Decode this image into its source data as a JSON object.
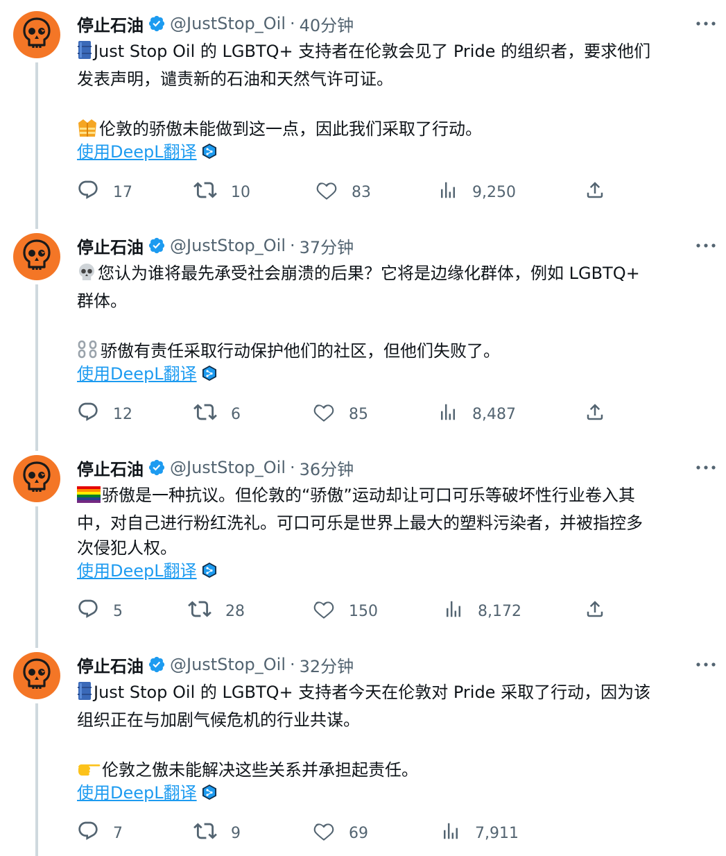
{
  "tweets": [
    {
      "name": "停止石油",
      "handle": "@JustStop_Oil",
      "separator": "·",
      "time": "40分钟",
      "lines": [
        {
          "emoji": "barrel-emoji",
          "text": "Just Stop Oil 的 LGBTQ+ 支持者在伦敦会见了 Pride 的组织者，要求他们"
        },
        {
          "emoji": "",
          "text": "发表声明，谴责新的石油和天然气许可证。"
        },
        {
          "emoji": "",
          "text": ""
        },
        {
          "emoji": "safety-vest-emoji",
          "text": "伦敦的骄傲未能做到这一点，因此我们采取了行动。"
        }
      ],
      "translate_label": "使用DeepL翻译",
      "replies": "17",
      "retweets": "10",
      "likes": "83",
      "views": "9,250",
      "show_share": true
    },
    {
      "name": "停止石油",
      "handle": "@JustStop_Oil",
      "separator": "·",
      "time": "37分钟",
      "lines": [
        {
          "emoji": "skull-emoji",
          "text": "您认为谁将最先承受社会崩溃的后果？它将是边缘化群体，例如 LGBTQ+"
        },
        {
          "emoji": "",
          "text": "群体。"
        },
        {
          "emoji": "",
          "text": ""
        },
        {
          "emoji": "broken-chain-emoji",
          "text": "骄傲有责任采取行动保护他们的社区，但他们失败了。"
        }
      ],
      "translate_label": "使用DeepL翻译",
      "replies": "12",
      "retweets": "6",
      "likes": "85",
      "views": "8,487",
      "show_share": true
    },
    {
      "name": "停止石油",
      "handle": "@JustStop_Oil",
      "separator": "·",
      "time": "36分钟",
      "lines": [
        {
          "emoji": "rainbow-flag-emoji",
          "text": "骄傲是一种抗议。但伦敦的“骄傲”运动却让可口可乐等破坏性行业卷入其"
        },
        {
          "emoji": "",
          "text": "中，对自己进行粉红洗礼。可口可乐是世界上最大的塑料污染者，并被指控多"
        },
        {
          "emoji": "",
          "text": "次侵犯人权。"
        }
      ],
      "translate_label": "使用DeepL翻译",
      "replies": "5",
      "retweets": "28",
      "likes": "150",
      "views": "8,172",
      "show_share": true
    },
    {
      "name": "停止石油",
      "handle": "@JustStop_Oil",
      "separator": "·",
      "time": "32分钟",
      "lines": [
        {
          "emoji": "barrel-emoji",
          "text": "Just Stop Oil 的 LGBTQ+ 支持者今天在伦敦对 Pride 采取了行动，因为该"
        },
        {
          "emoji": "",
          "text": "组织正在与加剧气候危机的行业共谋。"
        },
        {
          "emoji": "",
          "text": ""
        },
        {
          "emoji": "pointing-hand-emoji",
          "text": "伦敦之傲未能解决这些关系并承担起责任。"
        }
      ],
      "translate_label": "使用DeepL翻译",
      "replies": "7",
      "retweets": "9",
      "likes": "69",
      "views": "7,911",
      "show_share": false
    }
  ],
  "colors": {
    "avatar_bg": "#f47626",
    "verified": "#1d9bf0",
    "link": "#1d9bf0",
    "muted": "#536471",
    "thread_line": "#cfd9de"
  },
  "icons": {
    "verified": "verified-badge-icon",
    "more": "more-icon",
    "reply": "reply-icon",
    "retweet": "retweet-icon",
    "like": "heart-icon",
    "views": "views-icon",
    "share": "share-icon",
    "deepl": "deepl-icon"
  }
}
